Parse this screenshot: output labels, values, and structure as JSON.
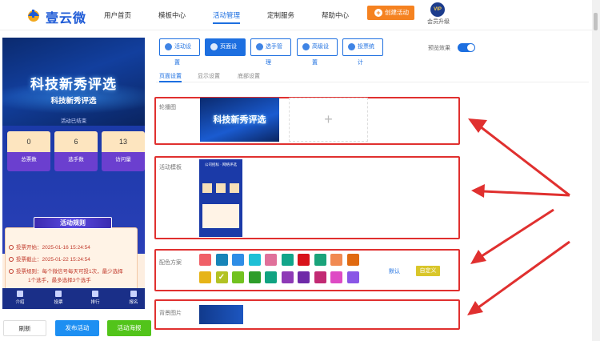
{
  "app": {
    "logo_text": "壹云微",
    "nav": [
      {
        "label": "用户首页"
      },
      {
        "label": "模板中心"
      },
      {
        "label": "活动管理"
      },
      {
        "label": "定制服务"
      },
      {
        "label": "帮助中心"
      }
    ],
    "create_label": "创建活动",
    "vip_badge": "VIP",
    "vip_label": "会员升级"
  },
  "preview": {
    "banner_title": "科技新秀评选",
    "title": "科技新秀评选",
    "status": "活动已结束",
    "stats": [
      {
        "value": "0",
        "label": "总票数"
      },
      {
        "value": "6",
        "label": "选手数"
      },
      {
        "value": "13",
        "label": "访问量"
      }
    ],
    "rules_title": "活动规则",
    "rules": [
      "投票开始：2025-01-16 15:24:54",
      "投票截止：2025-01-22 15:24:54",
      "投票规则：每个微信号每天可投1次，最少选择",
      "1个选手，最多选择3个选手"
    ],
    "tabs": [
      "介绍",
      "投票",
      "排行",
      "报名"
    ]
  },
  "actions": {
    "refresh": "刷新",
    "publish": "发布活动",
    "poster": "活动海报"
  },
  "settings_tabs": [
    {
      "label": "活动设置"
    },
    {
      "label": "页面设置"
    },
    {
      "label": "选手管理"
    },
    {
      "label": "高级设置"
    },
    {
      "label": "投票统计"
    }
  ],
  "preview_toggle_label": "预览效果",
  "sub_tabs": [
    "页面设置",
    "显示设置",
    "底部设置"
  ],
  "sections": {
    "carousel": {
      "label": "轮播图",
      "image_text": "科技新秀评选"
    },
    "template": {
      "label": "活动模板",
      "image_text": "公司招标 · 网络评选"
    },
    "colors": {
      "label": "配色方案",
      "row1": [
        "#f06068",
        "#1784b8",
        "#2e8de6",
        "#1fc0d6",
        "#e0709a",
        "#12a58a",
        "#d8131b",
        "#1aa37a",
        "#f18a52",
        "#e06a11"
      ],
      "row2": [
        "#e6b418",
        "#b2c224",
        "#72c21f",
        "#2e9d2a",
        "#10a381",
        "#8d3ab6",
        "#6f2aa8",
        "#c22a73",
        "#de4ac4",
        "#8a56e6"
      ],
      "selected_row": 2,
      "selected_index": 2,
      "default_label": "默认",
      "custom_label": "自定义"
    },
    "background": {
      "label": "背景图片"
    }
  },
  "colors": {
    "brand_blue": "#1d6fe0",
    "orange": "#f58220",
    "highlight_red": "#e0302f"
  }
}
